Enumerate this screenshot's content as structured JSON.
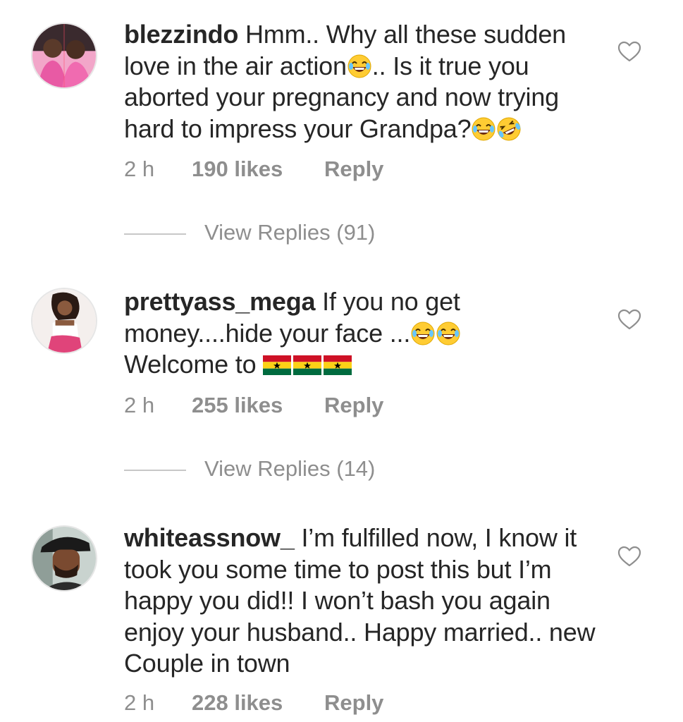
{
  "comments": [
    {
      "username": "blezzindo",
      "text_1": "Hmm.. Why all these sudden love in the air action",
      "text_2": ".. Is it true you aborted your pregnancy and now trying hard to impress your Grandpa?",
      "time": "2 h",
      "likes": "190 likes",
      "reply": "Reply",
      "view_replies": "View Replies (91)",
      "emojis": [
        "joy-emoji",
        "rofl-emoji"
      ]
    },
    {
      "username": "prettyass_mega",
      "text_1": "If you no get money....hide your face ...",
      "text_2": "Welcome to",
      "time": "2 h",
      "likes": "255 likes",
      "reply": "Reply",
      "view_replies": "View Replies (14)",
      "emojis": [
        "joy-emoji",
        "ghana-flag-emoji"
      ]
    },
    {
      "username": "whiteassnow_",
      "text_1": "I’m fulfilled now, I know it took you some time to post this but I’m happy you did!! I won’t bash you again enjoy your husband.. Happy married.. new Couple in town",
      "time": "2 h",
      "likes": "228 likes",
      "reply": "Reply"
    }
  ],
  "colors": {
    "text": "#262626",
    "meta": "#8e8e8e",
    "divider": "#c7c7c7",
    "background": "#ffffff"
  },
  "icons": [
    "heart-outline-icon"
  ]
}
